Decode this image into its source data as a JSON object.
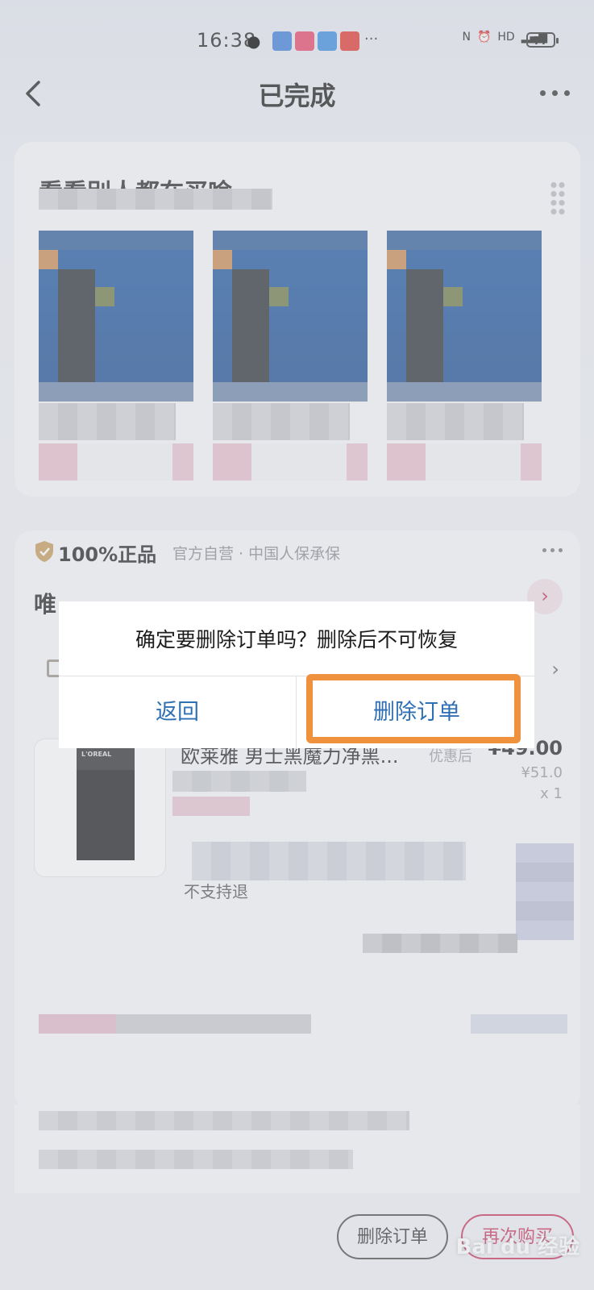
{
  "status_bar": {
    "time": "16:38",
    "battery": "77"
  },
  "nav": {
    "title": "已完成"
  },
  "recommend": {
    "title": "看看别人都在买啥"
  },
  "order": {
    "auth_label": "100%正品",
    "auth_sub": "官方自营 · 中国人保承保",
    "shop_label": "唯",
    "item": {
      "brand": "L'OREAL",
      "name": "欧莱雅 男士黑魔力净黑...",
      "price_tag": "优惠后",
      "price": "¥49.00",
      "original_price": "¥51.0",
      "quantity": "x 1",
      "note": "不支持退"
    }
  },
  "dialog": {
    "message": "确定要删除订单吗？删除后不可恢复",
    "back_label": "返回",
    "confirm_label": "删除订单"
  },
  "bottom_bar": {
    "delete_label": "删除订单",
    "rebuy_label": "再次购买",
    "watermark": "Bai du 经验"
  },
  "colors": {
    "accent_blue": "#2f6fb4",
    "highlight_orange": "#f0913e",
    "brand_red": "#c8365e"
  }
}
